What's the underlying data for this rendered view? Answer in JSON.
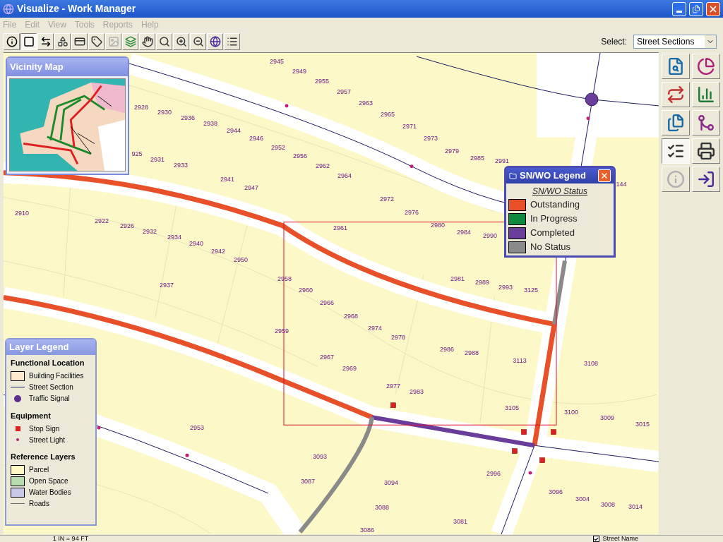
{
  "window": {
    "title": "Visualize - Work Manager"
  },
  "menu": [
    {
      "label": "File",
      "disabled": true
    },
    {
      "label": "Edit",
      "disabled": true
    },
    {
      "label": "View",
      "disabled": true
    },
    {
      "label": "Tools",
      "disabled": true
    },
    {
      "label": "Reports",
      "disabled": true
    },
    {
      "label": "Help",
      "disabled": true
    }
  ],
  "toolbar": {
    "tools": [
      {
        "selected": false,
        "disabled": false
      },
      {
        "selected": true,
        "disabled": false
      },
      {
        "selected": false,
        "disabled": false
      },
      {
        "selected": false,
        "disabled": false
      },
      {
        "selected": false,
        "disabled": false
      },
      {
        "selected": false,
        "disabled": false
      },
      {
        "selected": false,
        "disabled": true
      },
      {
        "selected": false,
        "disabled": false
      },
      {
        "selected": false,
        "disabled": false
      },
      {
        "selected": false,
        "disabled": false
      },
      {
        "selected": false,
        "disabled": false
      },
      {
        "selected": false,
        "disabled": false
      },
      {
        "selected": false,
        "disabled": false
      },
      {
        "selected": false,
        "disabled": false
      }
    ],
    "select_label": "Select:",
    "select_value": "Street Sections"
  },
  "side_tools": [
    {
      "selected": false,
      "disabled": false
    },
    {
      "selected": false,
      "disabled": false
    },
    {
      "selected": false,
      "disabled": false
    },
    {
      "selected": false,
      "disabled": false
    },
    {
      "selected": false,
      "disabled": false
    },
    {
      "selected": false,
      "disabled": false
    },
    {
      "selected": true,
      "disabled": false
    },
    {
      "selected": false,
      "disabled": false
    },
    {
      "selected": false,
      "disabled": true
    },
    {
      "selected": false,
      "disabled": false
    }
  ],
  "vicinity_map": {
    "title": "Vicinity Map"
  },
  "parcels": [
    "2945",
    "2949",
    "2955",
    "2957",
    "2963",
    "2965",
    "2971",
    "2973",
    "2979",
    "2985",
    "2991",
    "144",
    "2928",
    "2930",
    "2936",
    "2938",
    "2944",
    "2946",
    "2952",
    "2956",
    "2962",
    "2964",
    "925",
    "2931",
    "2933",
    "2941",
    "2947",
    "2972",
    "2976",
    "2980",
    "2984",
    "2990",
    "2910",
    "2922",
    "2926",
    "2932",
    "2934",
    "2940",
    "2942",
    "2950",
    "2961",
    "2937",
    "2958",
    "2960",
    "2966",
    "2968",
    "2974",
    "2978",
    "2981",
    "2989",
    "2993",
    "3125",
    "2959",
    "2967",
    "2969",
    "2986",
    "2988",
    "2977",
    "2983",
    "3113",
    "3108",
    "3105",
    "3100",
    "3009",
    "3015",
    "2953",
    "3093",
    "3087",
    "3094",
    "2996",
    "3096",
    "3088",
    "3004",
    "3008",
    "3014",
    "3081",
    "3086"
  ],
  "sn_wo_legend": {
    "title": "SN/WO Legend",
    "heading": "SN/WO Status",
    "items": [
      {
        "label": "Outstanding",
        "color": "#e8502a"
      },
      {
        "label": "In Progress",
        "color": "#0f8a3c"
      },
      {
        "label": "Completed",
        "color": "#6a3d9a"
      },
      {
        "label": "No Status",
        "color": "#8a8a8a"
      }
    ]
  },
  "layer_legend": {
    "title": "Layer Legend",
    "sections": [
      {
        "heading": "Functional Location",
        "items": [
          {
            "kind": "swatch",
            "label": "Building Facilities",
            "color": "#fde8cc"
          },
          {
            "kind": "line",
            "label": "Street Section",
            "color": "#1a1a5e"
          },
          {
            "kind": "signal",
            "label": "Traffic Signal",
            "color": "#5b2d8e"
          }
        ]
      },
      {
        "heading": "Equipment",
        "items": [
          {
            "kind": "stop",
            "label": "Stop Sign",
            "color": "#e02020"
          },
          {
            "kind": "light",
            "label": "Street Light",
            "color": "#c0207a"
          }
        ]
      },
      {
        "heading": "Reference Layers",
        "items": [
          {
            "kind": "swatch",
            "label": "Parcel",
            "color": "#fdf8c4"
          },
          {
            "kind": "swatch",
            "label": "Open Space",
            "color": "#b8dcb0"
          },
          {
            "kind": "swatch",
            "label": "Water Bodies",
            "color": "#c8c8e8"
          },
          {
            "kind": "line",
            "label": "Roads",
            "color": "#707070"
          }
        ]
      }
    ]
  },
  "status_bar": {
    "scale": "1 IN = 94 FT",
    "street_name": {
      "label": "Street Name",
      "checked": true
    }
  }
}
